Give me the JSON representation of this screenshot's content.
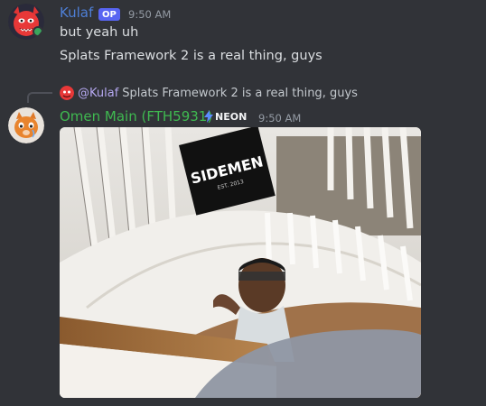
{
  "messages": [
    {
      "author": "Kulaf",
      "author_color": "#4e7fd6",
      "badge": "OP",
      "timestamp": "9:50 AM",
      "lines": [
        "but yeah uh",
        "Splats Framework 2 is a real thing, guys"
      ]
    },
    {
      "reply": {
        "mention": "@Kulaf",
        "text": "Splats Framework 2 is a real thing, guys"
      },
      "author": "Omen Main (FTH5931)",
      "author_color": "#3fb950",
      "badge": "NEON",
      "badge_icon": "lightning-bolt-icon",
      "timestamp": "9:50 AM",
      "attachment": {
        "type": "video-thumbnail",
        "banner_text": "SIDEMEN",
        "banner_subtext": "EST. 2013"
      }
    }
  ],
  "colors": {
    "background": "#313338",
    "text": "#dbdee1",
    "muted": "#949ba4",
    "op_badge": "#5865f2",
    "neon_bolt": "#5b8cff"
  }
}
